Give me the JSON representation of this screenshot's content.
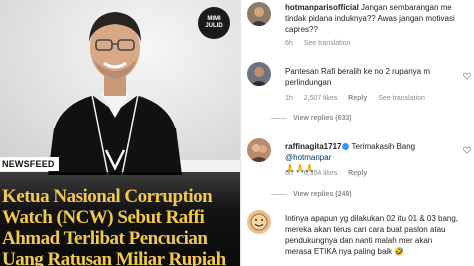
{
  "news": {
    "logo_line1": "MIMI",
    "logo_line2": "JULID",
    "badge": "NEWSFEED",
    "headline_lines": [
      "Ketua Nasional Corruption",
      "Watch (NCW) Sebut Raffi",
      "Ahmad Terlibat Pencucian",
      "Uang Ratusan Miliar Rupiah"
    ]
  },
  "comments": [
    {
      "username": "hotmanparisofficial",
      "verified": false,
      "text": "Jangan sembarangan me tindak pidana induknya?? Awas jangan motivasi capres??",
      "time": "6h",
      "likes": "",
      "see_translation": "See translation",
      "reply": "",
      "replies": ""
    },
    {
      "username": "",
      "verified": false,
      "text": "Pantesan Rafi beralih ke no 2 rupanya m perlindungan",
      "time": "1h",
      "likes": "2,507 likes",
      "see_translation": "See translation",
      "reply": "Reply",
      "replies": "View replies (633)"
    },
    {
      "username": "raffinagita1717",
      "verified": true,
      "text": "Terimakasih Bang",
      "mention": "@hotmanpar",
      "emoji_line": "🙏🙏🙏",
      "time": "6h",
      "likes": "6,354 likes",
      "see_translation": "",
      "reply": "Reply",
      "replies": "View replies (248)"
    },
    {
      "username": "",
      "verified": false,
      "text": "Intinya apapun yg dilakukan 02 itu 01 & 03 bang, mereka akan terus cari cara buat paslon atau pendukungnya dan nanti malah mer akan merasa ETIKA nya paling baik 🤣",
      "time": "",
      "likes": "",
      "see_translation": "",
      "reply": "",
      "replies": ""
    }
  ],
  "colors": {
    "headline": "#f2c94c",
    "meta": "#8e8e8e",
    "mention": "#00376b"
  },
  "icons": [
    "heart-outline-icon",
    "verified-badge-icon"
  ]
}
